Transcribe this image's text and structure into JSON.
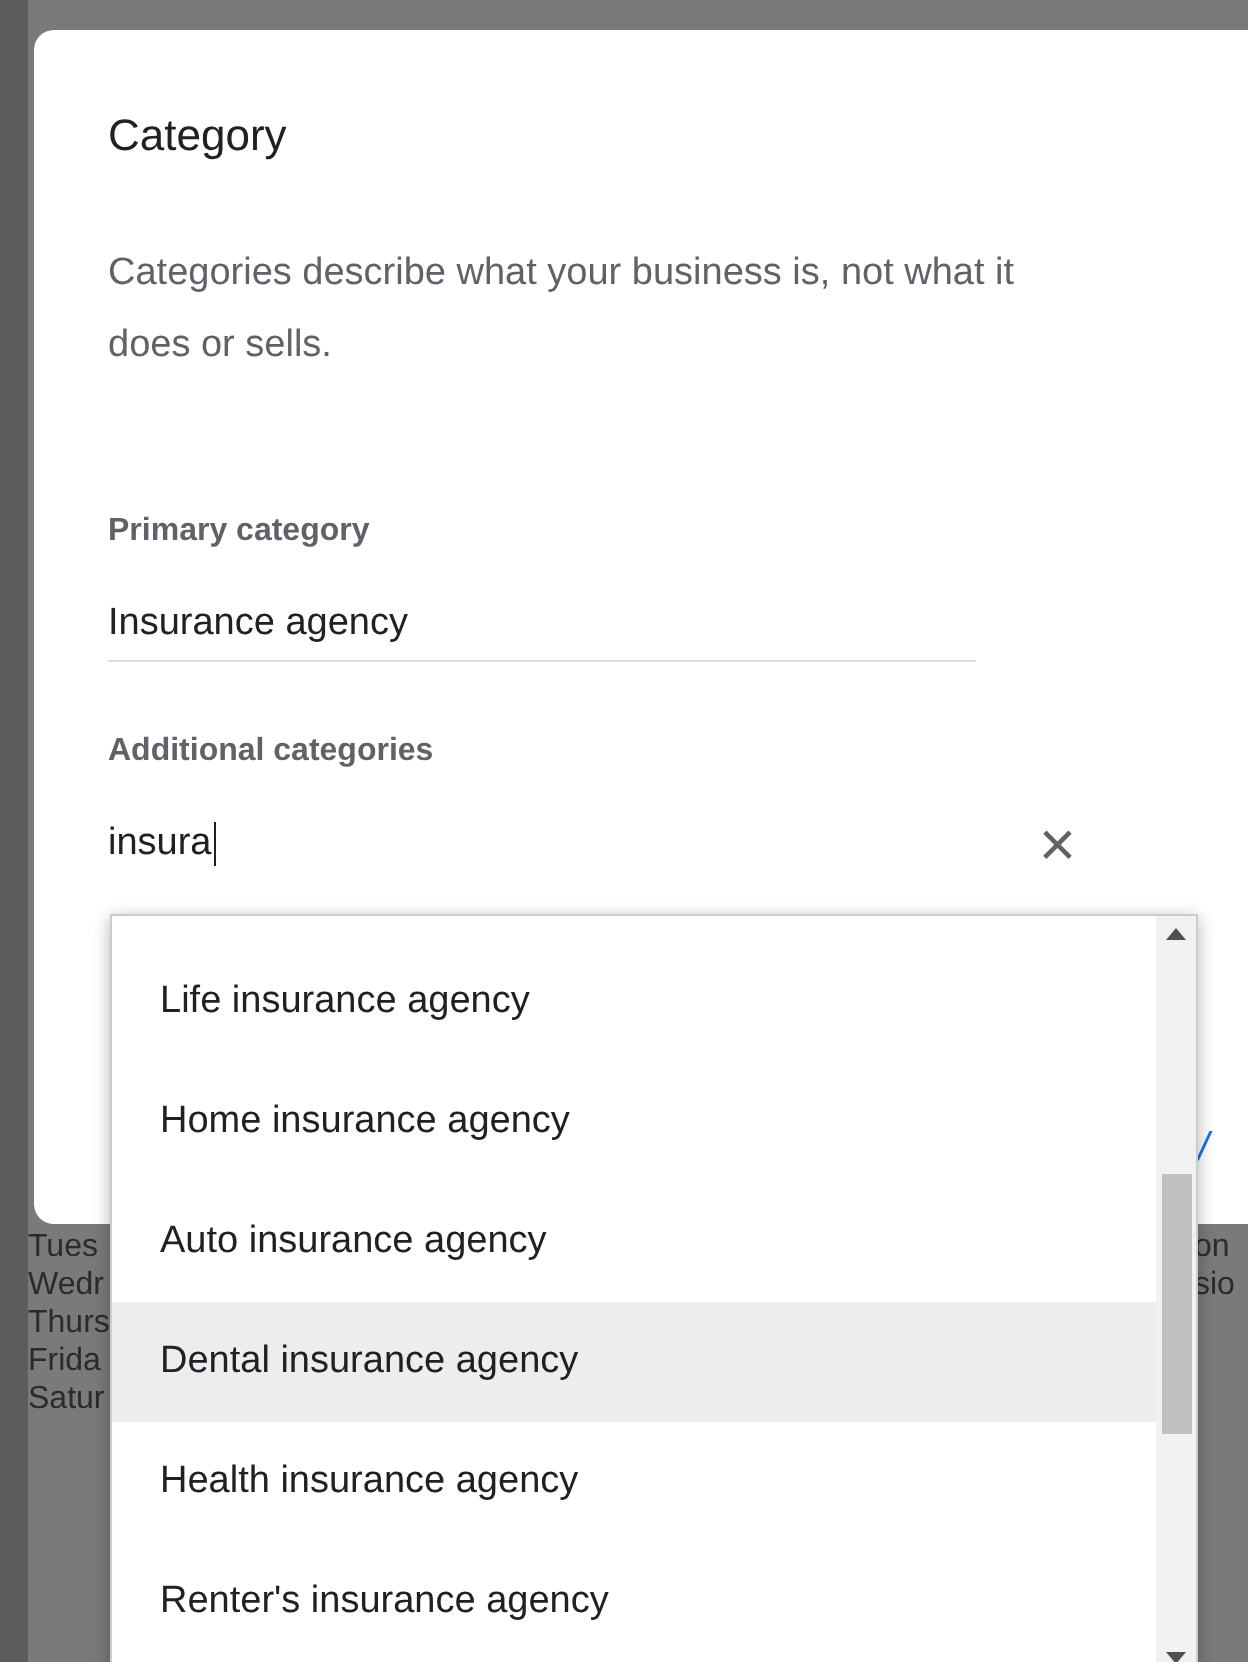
{
  "background": {
    "left_fragments": [
      "Tues",
      "Wedr",
      "Thurs",
      "Frida",
      "Satur"
    ],
    "right_fragments": [
      "on",
      "sio"
    ]
  },
  "dialog": {
    "title": "Category",
    "description": "Categories describe what your business is, not what it does or sells.",
    "primary": {
      "label": "Primary category",
      "value": "Insurance agency"
    },
    "additional": {
      "label": "Additional categories",
      "value": "insura",
      "clear": "×"
    },
    "link_fragment": "/"
  },
  "dropdown": {
    "items": [
      {
        "label": "Life insurance agency",
        "selected": false
      },
      {
        "label": "Home insurance agency",
        "selected": false
      },
      {
        "label": "Auto insurance agency",
        "selected": false
      },
      {
        "label": "Dental insurance agency",
        "selected": true
      },
      {
        "label": "Health insurance agency",
        "selected": false
      },
      {
        "label": "Renter's insurance agency",
        "selected": false
      }
    ]
  }
}
